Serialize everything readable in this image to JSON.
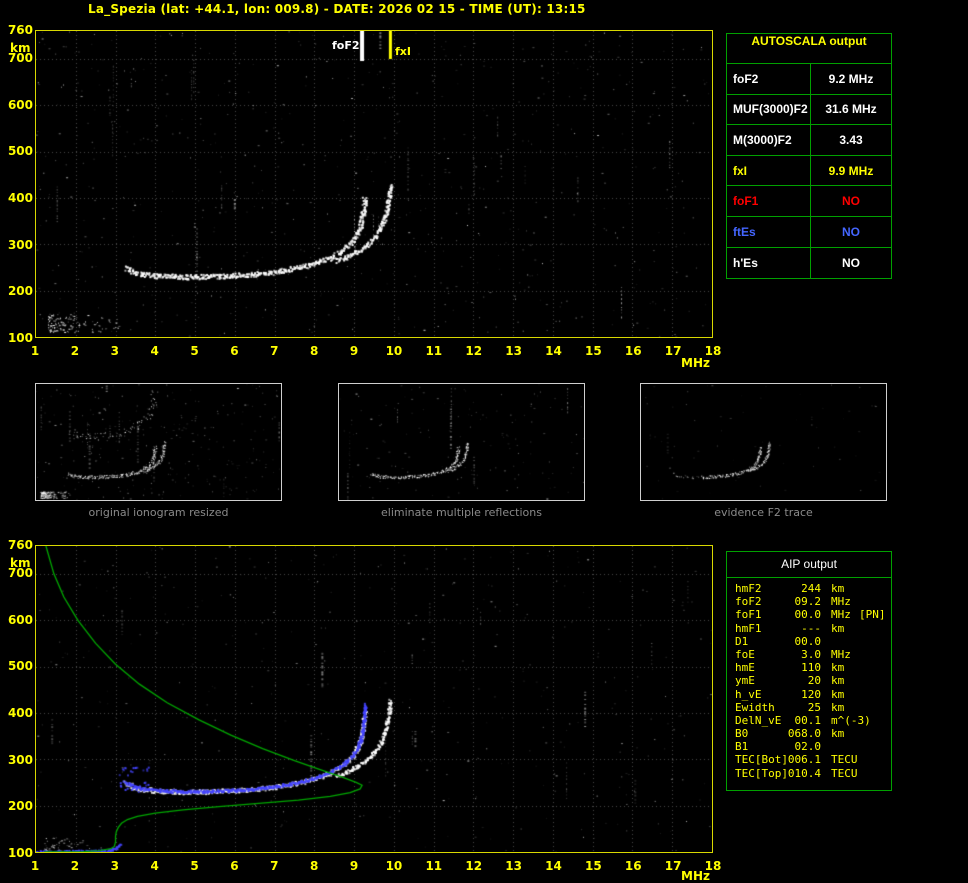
{
  "header": {
    "title": "La_Spezia (lat: +44.1, lon: 009.8) - DATE: 2026 02 15 - TIME (UT): 13:15"
  },
  "colors": {
    "background": "#000000",
    "header_text": "#ffff00",
    "plot_border": "#d8d800",
    "axis_text": "#ffff00",
    "grid": "#4a4a4a",
    "echo_white": "#ffffff",
    "restored_trace_blue": "#4444ff",
    "profile_green": "#00a800",
    "table_border": "#00a000",
    "thumbnail_border": "#cfcfcf",
    "caption_text": "#8a8a8a",
    "value_yellow": "#ffff00",
    "value_red": "#ff0000",
    "value_blue": "#4466ff",
    "value_white": "#ffffff"
  },
  "autoscala": {
    "title": "AUTOSCALA output",
    "rows": [
      {
        "label": "foF2",
        "value": "9.2 MHz",
        "color": "#ffffff"
      },
      {
        "label": "MUF(3000)F2",
        "value": "31.6 MHz",
        "color": "#ffffff"
      },
      {
        "label": "M(3000)F2",
        "value": "3.43",
        "color": "#ffffff"
      },
      {
        "label": "fxI",
        "value": "9.9 MHz",
        "color": "#ffff00"
      },
      {
        "label": "foF1",
        "value": "NO",
        "color": "#ff0000"
      },
      {
        "label": "ftEs",
        "value": "NO",
        "color": "#4466ff"
      },
      {
        "label": "h'Es",
        "value": "NO",
        "color": "#ffffff"
      }
    ]
  },
  "thumbnails": [
    {
      "caption": "original ionogram resized",
      "mode": "original",
      "seed": 21
    },
    {
      "caption": "eliminate multiple reflections",
      "mode": "clean",
      "seed": 22
    },
    {
      "caption": "evidence F2 trace",
      "mode": "f2",
      "seed": 23
    }
  ],
  "aip": {
    "title": "AIP output",
    "rows": [
      {
        "name": "hmF2",
        "value": "244",
        "unit": "km"
      },
      {
        "name": "foF2",
        "value": "09.2",
        "unit": "MHz"
      },
      {
        "name": "foF1",
        "value": "00.0",
        "unit": "MHz",
        "extra": "[PN]"
      },
      {
        "name": "hmF1",
        "value": "---",
        "unit": "km"
      },
      {
        "name": "D1",
        "value": "00.0",
        "unit": ""
      },
      {
        "name": "foE",
        "value": "3.0",
        "unit": "MHz"
      },
      {
        "name": "hmE",
        "value": "110",
        "unit": "km"
      },
      {
        "name": "ymE",
        "value": "20",
        "unit": "km"
      },
      {
        "name": "h_vE",
        "value": "120",
        "unit": "km"
      },
      {
        "name": "Ewidth",
        "value": "25",
        "unit": "km"
      },
      {
        "name": "DelN_vE",
        "value": "00.1",
        "unit": "m^(-3)"
      },
      {
        "name": "B0",
        "value": "068.0",
        "unit": "km"
      },
      {
        "name": "B1",
        "value": "02.0",
        "unit": ""
      },
      {
        "name": "TEC[Bot]",
        "value": "006.1",
        "unit": "TECU"
      },
      {
        "name": "TEC[Top]",
        "value": "010.4",
        "unit": "TECU"
      }
    ]
  },
  "chart_data": [
    {
      "id": "main-ionogram",
      "type": "scatter",
      "title": "ionogram with autoscaled critical frequencies",
      "xlabel": "MHz",
      "ylabel": "km",
      "xlim": [
        1,
        18
      ],
      "ylim": [
        100,
        760
      ],
      "x_ticks": [
        1,
        2,
        3,
        4,
        5,
        6,
        7,
        8,
        9,
        10,
        11,
        12,
        13,
        14,
        15,
        16,
        17,
        18
      ],
      "y_ticks": [
        760,
        700,
        600,
        500,
        400,
        300,
        200,
        100
      ],
      "grid": true,
      "markers": {
        "foF2": {
          "label": "foF2",
          "mhz": 9.2
        },
        "fxI": {
          "label": "fxI",
          "mhz": 9.9
        }
      },
      "o_trace": [
        [
          3.25,
          250
        ],
        [
          3.45,
          241
        ],
        [
          3.7,
          236
        ],
        [
          4.1,
          233
        ],
        [
          4.6,
          231
        ],
        [
          5.2,
          231
        ],
        [
          5.8,
          233
        ],
        [
          6.4,
          236
        ],
        [
          6.9,
          240
        ],
        [
          7.3,
          246
        ],
        [
          7.7,
          253
        ],
        [
          8.05,
          261
        ],
        [
          8.35,
          271
        ],
        [
          8.6,
          282
        ],
        [
          8.8,
          295
        ],
        [
          8.95,
          308
        ],
        [
          9.07,
          324
        ],
        [
          9.15,
          342
        ],
        [
          9.2,
          362
        ],
        [
          9.23,
          382
        ],
        [
          9.25,
          400
        ]
      ],
      "x_trace": [
        [
          8.55,
          266
        ],
        [
          8.8,
          274
        ],
        [
          9.05,
          285
        ],
        [
          9.3,
          299
        ],
        [
          9.5,
          316
        ],
        [
          9.65,
          335
        ],
        [
          9.75,
          356
        ],
        [
          9.82,
          380
        ],
        [
          9.87,
          405
        ],
        [
          9.9,
          428
        ]
      ],
      "es_cluster": {
        "f_min": 1.3,
        "f_max": 3.4,
        "h_min": 110,
        "h_max": 150,
        "dots": 130
      },
      "noise": {
        "dots": 650,
        "streaks": 26
      },
      "seed": 7
    },
    {
      "id": "profile-ionogram",
      "type": "scatter",
      "title": "ionogram with restored trace and electron density profile",
      "xlabel": "MHz",
      "ylabel": "km",
      "xlim": [
        1,
        18
      ],
      "ylim": [
        100,
        760
      ],
      "x_ticks": [
        1,
        2,
        3,
        4,
        5,
        6,
        7,
        8,
        9,
        10,
        11,
        12,
        13,
        14,
        15,
        16,
        17,
        18
      ],
      "y_ticks": [
        760,
        700,
        600,
        500,
        400,
        300,
        200,
        100
      ],
      "grid": true,
      "o_trace": [
        [
          3.25,
          250
        ],
        [
          3.45,
          241
        ],
        [
          3.7,
          236
        ],
        [
          4.1,
          233
        ],
        [
          4.6,
          231
        ],
        [
          5.2,
          231
        ],
        [
          5.8,
          233
        ],
        [
          6.4,
          236
        ],
        [
          6.9,
          240
        ],
        [
          7.3,
          246
        ],
        [
          7.7,
          253
        ],
        [
          8.05,
          261
        ],
        [
          8.35,
          271
        ],
        [
          8.6,
          282
        ],
        [
          8.8,
          295
        ],
        [
          8.95,
          308
        ],
        [
          9.07,
          324
        ],
        [
          9.15,
          342
        ],
        [
          9.2,
          362
        ],
        [
          9.23,
          382
        ],
        [
          9.25,
          400
        ]
      ],
      "x_trace": [
        [
          8.55,
          266
        ],
        [
          8.8,
          274
        ],
        [
          9.05,
          285
        ],
        [
          9.3,
          299
        ],
        [
          9.5,
          316
        ],
        [
          9.65,
          335
        ],
        [
          9.75,
          356
        ],
        [
          9.82,
          380
        ],
        [
          9.87,
          405
        ],
        [
          9.9,
          428
        ]
      ],
      "blue_trace": [
        [
          3.2,
          252
        ],
        [
          3.45,
          242
        ],
        [
          3.7,
          237
        ],
        [
          4.1,
          234
        ],
        [
          4.6,
          232
        ],
        [
          5.2,
          232
        ],
        [
          5.8,
          234
        ],
        [
          6.4,
          237
        ],
        [
          6.9,
          241
        ],
        [
          7.3,
          247
        ],
        [
          7.7,
          254
        ],
        [
          8.05,
          262
        ],
        [
          8.35,
          272
        ],
        [
          8.6,
          283
        ],
        [
          8.8,
          296
        ],
        [
          8.95,
          309
        ],
        [
          9.07,
          325
        ],
        [
          9.15,
          343
        ],
        [
          9.2,
          363
        ],
        [
          9.23,
          385
        ],
        [
          9.25,
          405
        ],
        [
          9.26,
          420
        ]
      ],
      "blue_e_trace": [
        [
          1.0,
          102
        ],
        [
          1.5,
          102
        ],
        [
          2.0,
          103
        ],
        [
          2.5,
          103
        ],
        [
          2.85,
          105
        ],
        [
          3.0,
          110
        ],
        [
          3.1,
          118
        ]
      ],
      "green_profile": [
        [
          1.25,
          760
        ],
        [
          1.45,
          700
        ],
        [
          1.7,
          650
        ],
        [
          2.05,
          600
        ],
        [
          2.5,
          550
        ],
        [
          3.0,
          505
        ],
        [
          3.6,
          462
        ],
        [
          4.3,
          422
        ],
        [
          5.1,
          385
        ],
        [
          5.9,
          352
        ],
        [
          6.7,
          323
        ],
        [
          7.5,
          297
        ],
        [
          8.2,
          276
        ],
        [
          8.75,
          260
        ],
        [
          9.05,
          250
        ],
        [
          9.2,
          244
        ],
        [
          9.15,
          236
        ],
        [
          8.9,
          228
        ],
        [
          8.4,
          220
        ],
        [
          7.6,
          212
        ],
        [
          6.6,
          205
        ],
        [
          5.6,
          198
        ],
        [
          4.7,
          191
        ],
        [
          4.0,
          184
        ],
        [
          3.55,
          177
        ],
        [
          3.3,
          170
        ],
        [
          3.15,
          162
        ],
        [
          3.07,
          153
        ],
        [
          3.02,
          144
        ],
        [
          3.0,
          134
        ],
        [
          3.0,
          122
        ],
        [
          2.97,
          112
        ],
        [
          2.88,
          107
        ],
        [
          2.6,
          103
        ],
        [
          2.2,
          101
        ],
        [
          1.7,
          100
        ],
        [
          1.2,
          100
        ]
      ],
      "es_cluster": {
        "f_min": 1.2,
        "f_max": 3.0,
        "h_min": 100,
        "h_max": 132,
        "dots": 55
      },
      "noise": {
        "dots": 430,
        "streaks": 16
      },
      "seed": 13
    }
  ]
}
